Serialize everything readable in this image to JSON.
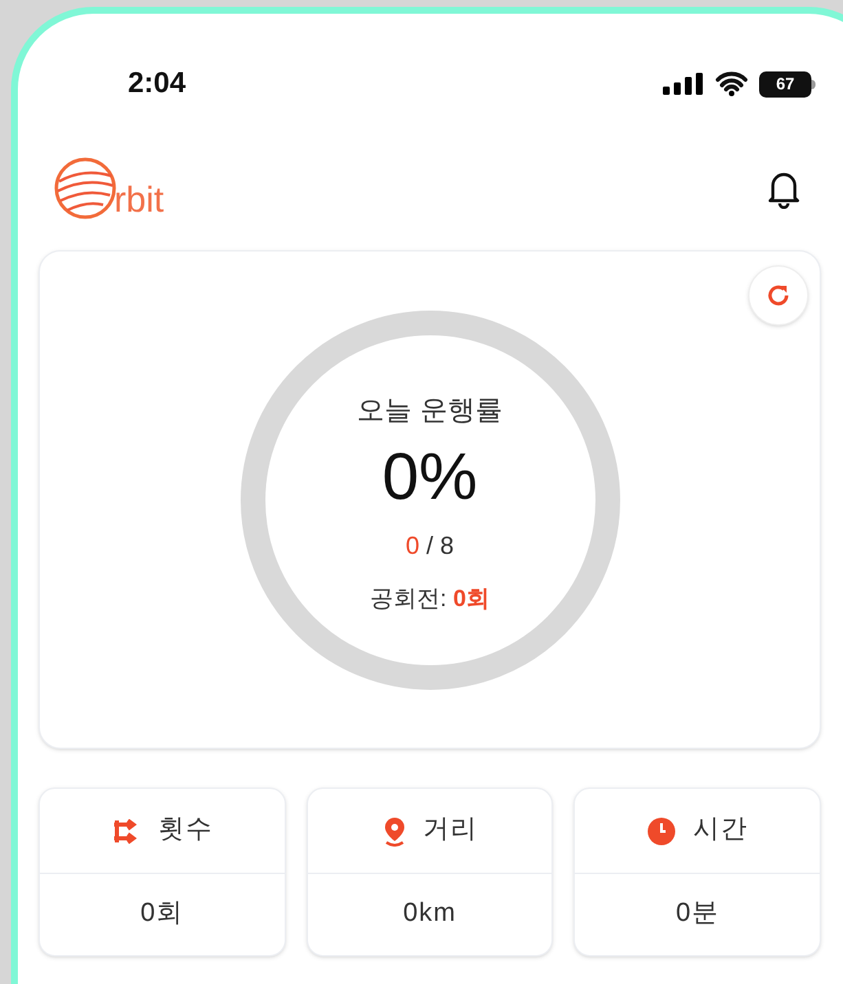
{
  "status_bar": {
    "time": "2:04",
    "battery": "67"
  },
  "header": {
    "logo_text": "rbit"
  },
  "progress": {
    "title": "오늘 운행률",
    "percent": "0%",
    "done": "0",
    "total": " / 8",
    "idle_label": "공회전: ",
    "idle_value": "0회"
  },
  "stats": [
    {
      "kind": "count",
      "label": "횟수",
      "value": "0회"
    },
    {
      "kind": "distance",
      "label": "거리",
      "value": "0km"
    },
    {
      "kind": "time",
      "label": "시간",
      "value": "0분"
    }
  ]
}
